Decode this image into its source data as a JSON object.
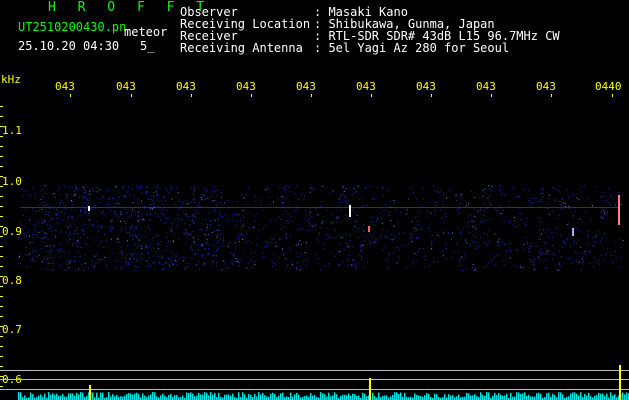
{
  "app": {
    "name": "H R O F F T"
  },
  "file": {
    "name": "UT2510200430.pn",
    "mode": "meteor",
    "datetime": "25.10.20 04:30",
    "count": "5_"
  },
  "info": {
    "rows": [
      {
        "label": "Observer",
        "value": ": Masaki Kano"
      },
      {
        "label": "Receiving Location",
        "value": ": Shibukawa, Gunma, Japan"
      },
      {
        "label": "Receiver",
        "value": ": RTL-SDR SDR# 43dB L15 96.7MHz CW"
      },
      {
        "label": "Receiving Antenna",
        "value": ": 5el Yagi Az 280 for Seoul"
      }
    ]
  },
  "axis": {
    "y_unit": "kHz",
    "y_ticks": [
      "1.1",
      "1.0",
      "0.9",
      "0.8",
      "0.7",
      "0.6"
    ],
    "x_ticks": [
      "043",
      "043",
      "043",
      "043",
      "043",
      "043",
      "043",
      "043",
      "043",
      "0440"
    ]
  },
  "colors": {
    "bg": "#000000",
    "app": "#00ff00",
    "axis": "#ffff00",
    "signal": "#3a3aff",
    "meter": "#00ffff"
  }
}
